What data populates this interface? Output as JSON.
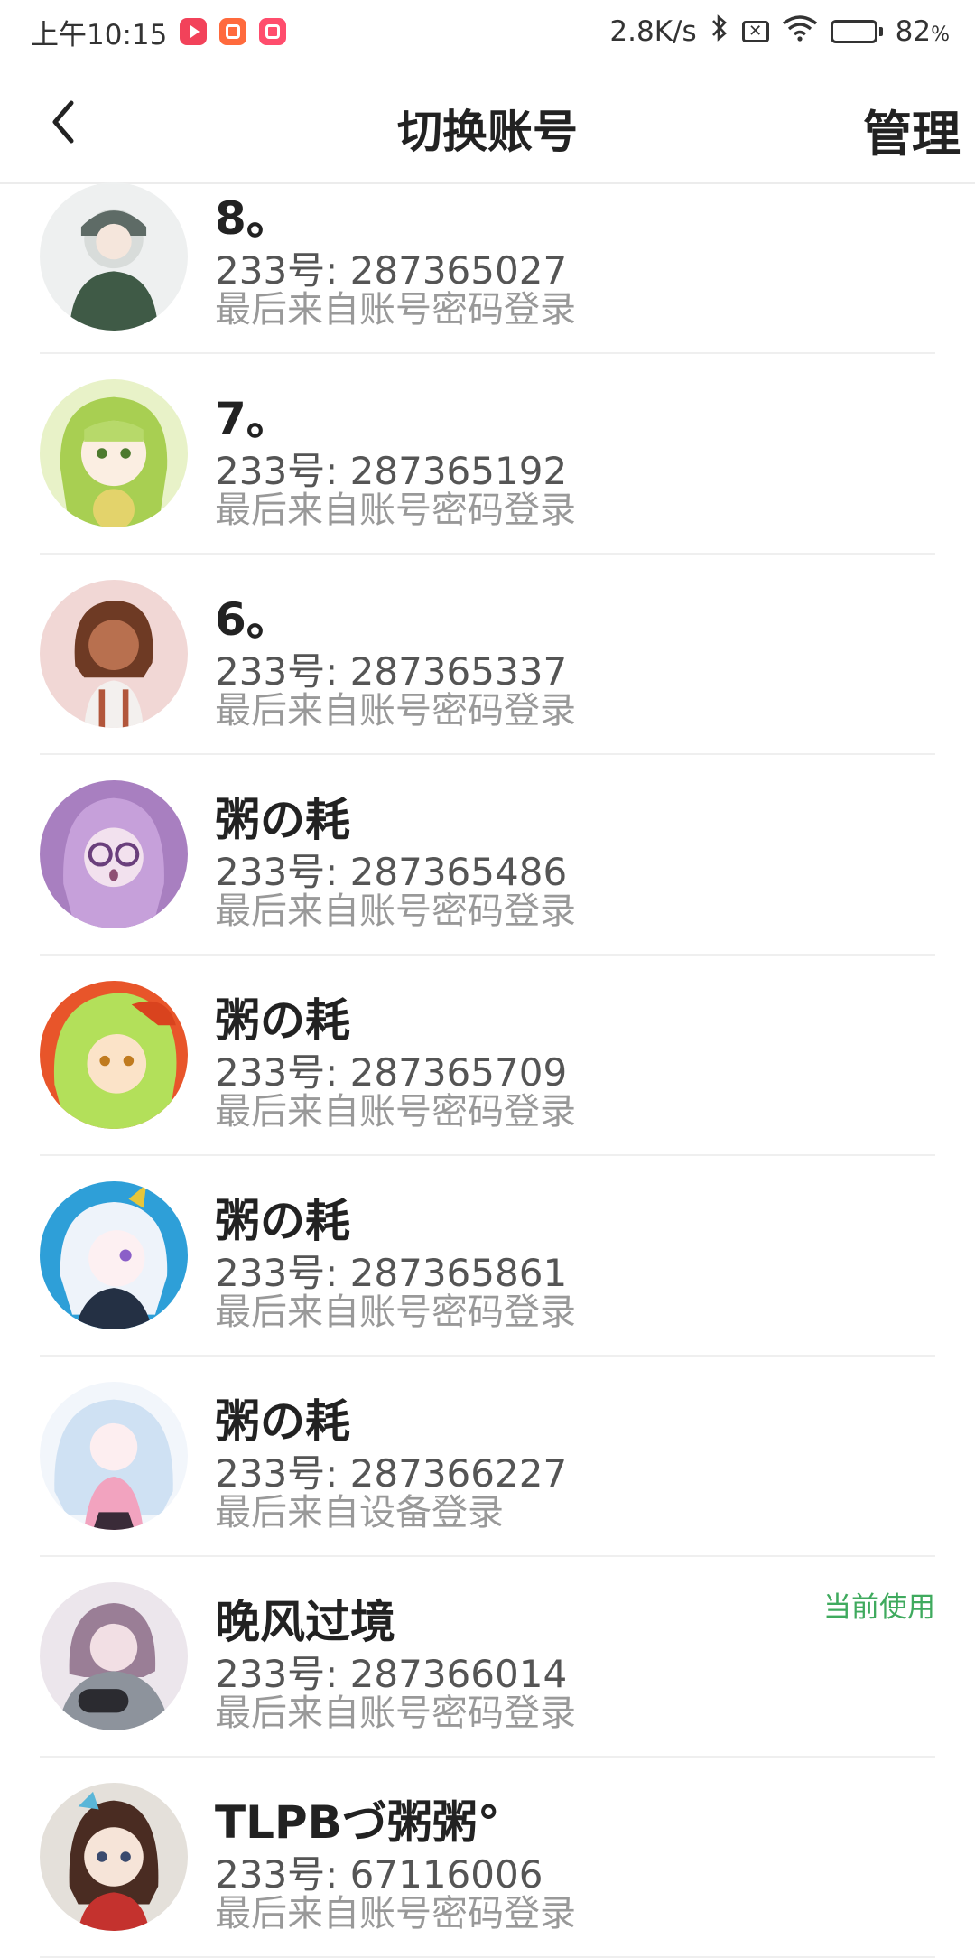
{
  "status_bar": {
    "time": "上午10:15",
    "network_speed": "2.8K/s",
    "battery_percent": "82",
    "battery_unit": "%",
    "battery_level": 0.82,
    "notification_icons": [
      "video-app-icon",
      "kuaishou-icon",
      "kuaishou-icon"
    ]
  },
  "header": {
    "title": "切换账号",
    "manage_label": "管理"
  },
  "accounts": [
    {
      "name": "8。",
      "id_line": "233号: 287365027",
      "login_source": "最后来自账号密码登录",
      "current": ""
    },
    {
      "name": "7。",
      "id_line": "233号: 287365192",
      "login_source": "最后来自账号密码登录",
      "current": ""
    },
    {
      "name": "6。",
      "id_line": "233号: 287365337",
      "login_source": "最后来自账号密码登录",
      "current": ""
    },
    {
      "name": "粥の耗",
      "id_line": "233号: 287365486",
      "login_source": "最后来自账号密码登录",
      "current": ""
    },
    {
      "name": "粥の耗",
      "id_line": "233号: 287365709",
      "login_source": "最后来自账号密码登录",
      "current": ""
    },
    {
      "name": "粥の耗",
      "id_line": "233号: 287365861",
      "login_source": "最后来自账号密码登录",
      "current": ""
    },
    {
      "name": "粥の耗",
      "id_line": "233号: 287366227",
      "login_source": "最后来自设备登录",
      "current": ""
    },
    {
      "name": "晚风过境",
      "id_line": "233号: 287366014",
      "login_source": "最后来自账号密码登录",
      "current": "当前使用"
    },
    {
      "name": "TLPBづ粥粥°",
      "id_line": "233号: 67116006",
      "login_source": "最后来自账号密码登录",
      "current": ""
    }
  ],
  "colors": {
    "accent_green": "#3faa5e",
    "text_primary": "#222222",
    "text_secondary": "#555555",
    "text_muted": "#999999"
  }
}
